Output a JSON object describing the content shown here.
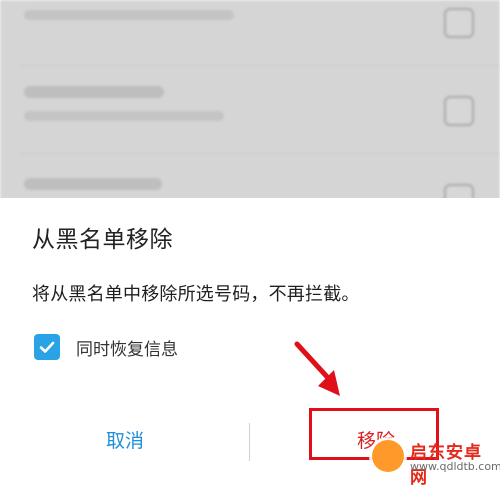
{
  "dialog": {
    "title": "从黑名单移除",
    "message": "将从黑名单中移除所选号码，不再拦截。",
    "checkbox_label": "同时恢复信息",
    "checkbox_checked": true,
    "cancel_label": "取消",
    "remove_label": "移除"
  },
  "colors": {
    "accent": "#2aa3e6",
    "cancel_text": "#1d8fdb",
    "remove_text": "#d92020",
    "annotation": "#e0101a"
  },
  "watermark": {
    "line1": "启东安卓网",
    "line2": "www.qdldtb.com"
  }
}
